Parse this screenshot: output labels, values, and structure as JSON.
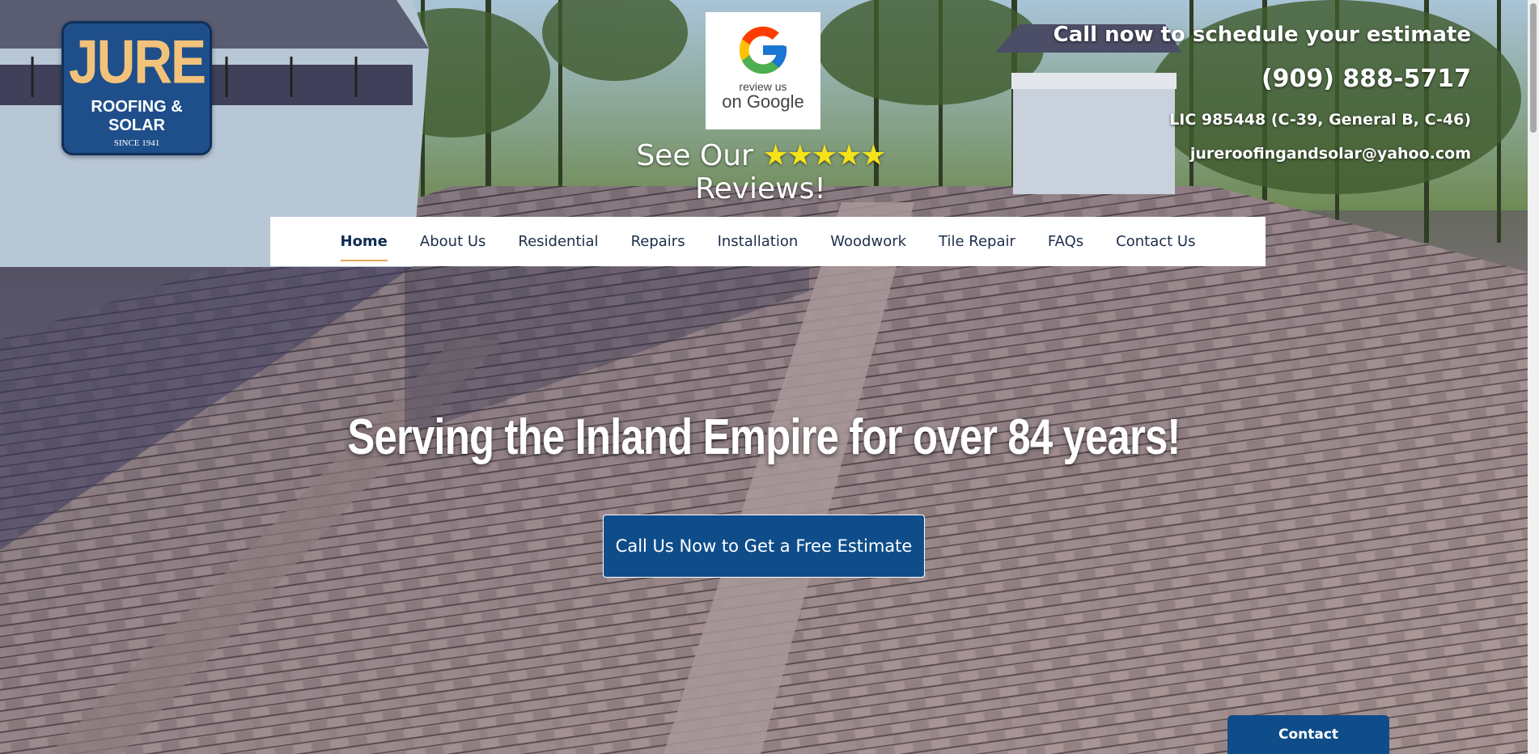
{
  "logo": {
    "brand": "JURE",
    "sub": "ROOFING & SOLAR",
    "since": "SINCE 1941"
  },
  "google_badge": {
    "line1": "review us",
    "line2": "on Google",
    "icon": "google-g-icon"
  },
  "reviews": {
    "prefix": "See Our",
    "stars": "★★★★★",
    "suffix": "Reviews!"
  },
  "contact_info": {
    "call_line": "Call now to schedule your estimate",
    "phone": "(909) 888-5717",
    "license": "LIC 985448 (C-39, General B, C-46)",
    "email": "jureroofingandsolar@yahoo.com"
  },
  "nav": {
    "items": [
      {
        "label": "Home",
        "active": true
      },
      {
        "label": "About Us"
      },
      {
        "label": "Residential"
      },
      {
        "label": "Repairs"
      },
      {
        "label": "Installation"
      },
      {
        "label": "Woodwork"
      },
      {
        "label": "Tile Repair"
      },
      {
        "label": "FAQs"
      },
      {
        "label": "Contact Us"
      }
    ]
  },
  "hero": {
    "headline": "Serving the Inland Empire for over 84 years!",
    "cta_label": "Call Us Now to Get a Free Estimate"
  },
  "contact_tab": {
    "label": "Contact"
  },
  "colors": {
    "brand_blue": "#0f4d8a",
    "accent_orange": "#e7a45a",
    "star_yellow": "#f4e21a"
  }
}
